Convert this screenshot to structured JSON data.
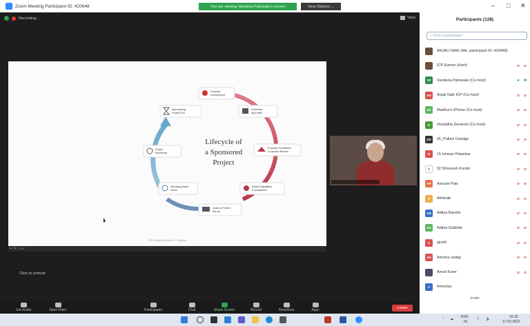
{
  "window": {
    "title": "Zoom Meeting Participant ID: 420648",
    "share_banner": "You are viewing Vandana Patravale's screen",
    "view_options": "View Options ⌄",
    "minimize": "–",
    "maximize": "□",
    "close": "✕"
  },
  "meeting": {
    "recording": "Recording...",
    "view": "View",
    "click_unmute": "Click to unmute",
    "slide": {
      "title_line1": "Lifecycle of",
      "title_line2": "a Sponsored",
      "title_line3": "Project",
      "footer": "TYB Research Ethics, ICT Mumbai",
      "steps": [
        {
          "label1": "Proposal",
          "label2": "Development"
        },
        {
          "label1": "University",
          "label2": "Approvals"
        },
        {
          "label1": "Proposal Submission",
          "label2": "& Sponsor Review"
        },
        {
          "label1": "Award Negotiation",
          "label2": "& Acceptance"
        },
        {
          "label1": "Award & Project",
          "label2": "Set-Up"
        },
        {
          "label1": "Spending Award",
          "label2": "Funds"
        },
        {
          "label1": "Project",
          "label2": "Monitoring"
        },
        {
          "label1": "Approaching",
          "label2": "Project End"
        }
      ]
    }
  },
  "toolbar": {
    "items": [
      {
        "label": "Join Audio",
        "icon": "headphones-icon"
      },
      {
        "label": "Start Video",
        "icon": "video-off-icon"
      },
      {
        "label": "Participants",
        "icon": "people-icon"
      },
      {
        "label": "Chat",
        "icon": "chat-icon"
      },
      {
        "label": "Share Screen",
        "icon": "share-icon"
      },
      {
        "label": "Record",
        "icon": "record-icon"
      },
      {
        "label": "Reactions",
        "icon": "smile-icon"
      },
      {
        "label": "Apps",
        "icon": "apps-icon"
      }
    ],
    "participants_count": "128",
    "leave": "Leave"
  },
  "panel": {
    "title": "Participants (128)",
    "search_placeholder": "Find a participant",
    "invite": "Invite",
    "participants": [
      {
        "initials": "",
        "name": "ANJALI NAIK (Me, participant ID: 420648)",
        "color": "#6b4e3d",
        "mic": "",
        "cam": ""
      },
      {
        "initials": "",
        "name": "ICP Events (Host)",
        "color": "#6b4e3d",
        "mic": "⌀",
        "cam": "⌀"
      },
      {
        "initials": "VP",
        "name": "Vandana Patravale (Co-host)",
        "color": "#2e8b57",
        "mic": "●",
        "cam": "■"
      },
      {
        "initials": "AN",
        "name": "Anjali Naik ICP (Co-host)",
        "color": "#d9534f",
        "mic": "⌀",
        "cam": "⌀"
      },
      {
        "initials": "MI",
        "name": "Madhur's iPhone (Co-host)",
        "color": "#5cb85c",
        "mic": "⌀",
        "cam": "⌀"
      },
      {
        "initials": "D",
        "name": "shraddha Devarshi (Co-host)",
        "color": "#4a9a3a",
        "mic": "⌀",
        "cam": "⌀"
      },
      {
        "initials": "DD",
        "name": "05_Pallavi Dandge",
        "color": "#333333",
        "mic": "⌀",
        "cam": "⌀"
      },
      {
        "initials": "1I",
        "name": "15 Ishwari Patankar",
        "color": "#d9534f",
        "mic": "⌀",
        "cam": "⌀"
      },
      {
        "initials": "S",
        "name": "32.Shreyesh Konde",
        "color": "#ffffff",
        "mic": "⌀",
        "cam": "⌀"
      },
      {
        "initials": "AP",
        "name": "Aarushi Pais",
        "color": "#e8734a",
        "mic": "⌀",
        "cam": "⌀"
      },
      {
        "initials": "A",
        "name": "Abhinab",
        "color": "#f0ad4e",
        "mic": "⌀",
        "cam": "⌀"
      },
      {
        "initials": "AB",
        "name": "Aditya Bandre",
        "color": "#3a6fc4",
        "mic": "⌀",
        "cam": "⌀"
      },
      {
        "initials": "AG",
        "name": "Aditya Gulbhile",
        "color": "#5cb85c",
        "mic": "⌀",
        "cam": "⌀"
      },
      {
        "initials": "A",
        "name": "ajoshi",
        "color": "#d9534f",
        "mic": "⌀",
        "cam": "⌀"
      },
      {
        "initials": "AN",
        "name": "Amisha nadap",
        "color": "#d9534f",
        "mic": "⌀",
        "cam": "⌀"
      },
      {
        "initials": "",
        "name": "Amod Kane",
        "color": "#4a4a6a",
        "mic": "⌀",
        "cam": "⌀"
      },
      {
        "initials": "A",
        "name": "Amoolya",
        "color": "#3a6fc4",
        "mic": "",
        "cam": ""
      }
    ]
  },
  "taskbar": {
    "lang": "ENG",
    "region": "IN",
    "time": "16:33",
    "date": "17-02-2022"
  }
}
